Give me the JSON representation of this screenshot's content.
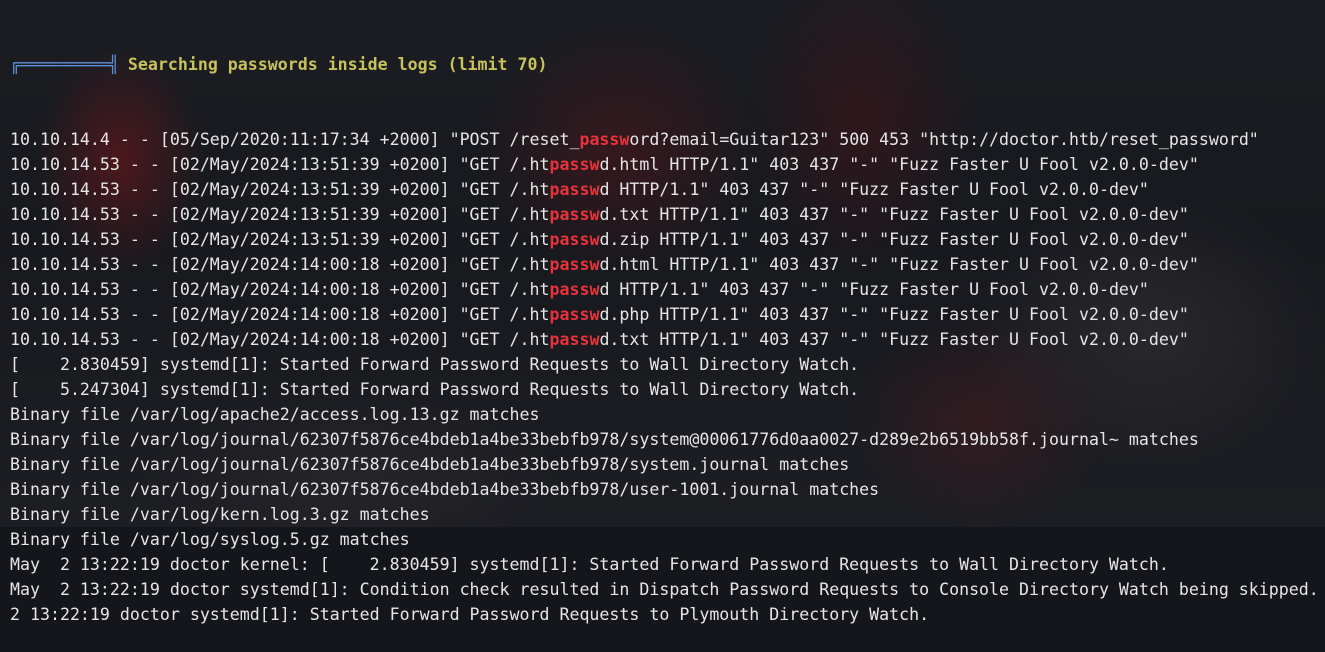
{
  "header": {
    "box": "╔══════════╣",
    "title": "Searching passwords inside logs (limit 70)"
  },
  "highlight_color": "#e8333a",
  "lines": [
    {
      "pre": "10.10.14.4 - - [05/Sep/2020:11:17:34 +2000] \"POST /reset_",
      "hl": "passw",
      "post": "ord?email=Guitar123\" 500 453 \"http://doctor.htb/reset_password\""
    },
    {
      "pre": "10.10.14.53 - - [02/May/2024:13:51:39 +0200] \"GET /.ht",
      "hl": "passw",
      "post": "d.html HTTP/1.1\" 403 437 \"-\" \"Fuzz Faster U Fool v2.0.0-dev\""
    },
    {
      "pre": "10.10.14.53 - - [02/May/2024:13:51:39 +0200] \"GET /.ht",
      "hl": "passw",
      "post": "d HTTP/1.1\" 403 437 \"-\" \"Fuzz Faster U Fool v2.0.0-dev\""
    },
    {
      "pre": "10.10.14.53 - - [02/May/2024:13:51:39 +0200] \"GET /.ht",
      "hl": "passw",
      "post": "d.txt HTTP/1.1\" 403 437 \"-\" \"Fuzz Faster U Fool v2.0.0-dev\""
    },
    {
      "pre": "10.10.14.53 - - [02/May/2024:13:51:39 +0200] \"GET /.ht",
      "hl": "passw",
      "post": "d.zip HTTP/1.1\" 403 437 \"-\" \"Fuzz Faster U Fool v2.0.0-dev\""
    },
    {
      "pre": "10.10.14.53 - - [02/May/2024:14:00:18 +0200] \"GET /.ht",
      "hl": "passw",
      "post": "d.html HTTP/1.1\" 403 437 \"-\" \"Fuzz Faster U Fool v2.0.0-dev\""
    },
    {
      "pre": "10.10.14.53 - - [02/May/2024:14:00:18 +0200] \"GET /.ht",
      "hl": "passw",
      "post": "d HTTP/1.1\" 403 437 \"-\" \"Fuzz Faster U Fool v2.0.0-dev\""
    },
    {
      "pre": "10.10.14.53 - - [02/May/2024:14:00:18 +0200] \"GET /.ht",
      "hl": "passw",
      "post": "d.php HTTP/1.1\" 403 437 \"-\" \"Fuzz Faster U Fool v2.0.0-dev\""
    },
    {
      "pre": "10.10.14.53 - - [02/May/2024:14:00:18 +0200] \"GET /.ht",
      "hl": "passw",
      "post": "d.txt HTTP/1.1\" 403 437 \"-\" \"Fuzz Faster U Fool v2.0.0-dev\""
    },
    {
      "pre": "[    2.830459] systemd[1]: Started Forward Password Requests to Wall Directory Watch.",
      "hl": "",
      "post": ""
    },
    {
      "pre": "[    5.247304] systemd[1]: Started Forward Password Requests to Wall Directory Watch.",
      "hl": "",
      "post": ""
    },
    {
      "pre": "Binary file /var/log/apache2/access.log.13.gz matches",
      "hl": "",
      "post": ""
    },
    {
      "pre": "Binary file /var/log/journal/62307f5876ce4bdeb1a4be33bebfb978/system@00061776d0aa0027-d289e2b6519bb58f.journal~ matches",
      "hl": "",
      "post": ""
    },
    {
      "pre": "Binary file /var/log/journal/62307f5876ce4bdeb1a4be33bebfb978/system.journal matches",
      "hl": "",
      "post": ""
    },
    {
      "pre": "Binary file /var/log/journal/62307f5876ce4bdeb1a4be33bebfb978/user-1001.journal matches",
      "hl": "",
      "post": ""
    },
    {
      "pre": "Binary file /var/log/kern.log.3.gz matches",
      "hl": "",
      "post": ""
    },
    {
      "pre": "Binary file /var/log/syslog.5.gz matches",
      "hl": "",
      "post": ""
    },
    {
      "pre": "May  2 13:22:19 doctor kernel: [    2.830459] systemd[1]: Started Forward Password Requests to Wall Directory Watch.",
      "hl": "",
      "post": ""
    },
    {
      "pre": "May  2 13:22:19 doctor systemd[1]: Condition check resulted in Dispatch Password Requests to Console Directory Watch being skipped.",
      "hl": "",
      "post": ""
    },
    {
      "pre": "2 13:22:19 doctor systemd[1]: Started Forward Password Requests to Plymouth Directory Watch.",
      "hl": "",
      "post": ""
    }
  ]
}
